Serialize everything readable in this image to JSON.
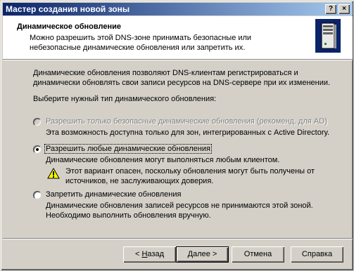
{
  "window": {
    "title": "Мастер создания новой зоны",
    "help_glyph": "?",
    "close_glyph": "×"
  },
  "header": {
    "title": "Динамическое обновление",
    "description": "Можно разрешить этой DNS-зоне принимать безопасные или небезопасные динамические обновления или запретить их.",
    "icon": "server-icon"
  },
  "body": {
    "intro": "Динамические обновления позволяют DNS-клиентам регистрироваться и динамически обновлять свои записи ресурсов на DNS-сервере при их изменении.",
    "prompt": "Выберите нужный тип динамического обновления:"
  },
  "options": [
    {
      "label": "Разрешить только безопасные динамические обновления (рекоменд. для AD)",
      "description": "Эта возможность доступна только для зон, интегрированных с Active Directory.",
      "state": "disabled"
    },
    {
      "label": "Разрешить любые динамические обновления",
      "description": "Динамические обновления могут выполняться любым клиентом.",
      "warning": "Этот вариант опасен, поскольку обновления могут быть получены от источников, не заслуживающих доверия.",
      "state": "selected"
    },
    {
      "label": "Запретить динамические обновления",
      "description": "Динамические обновления записей ресурсов не принимаются этой зоной. Необходимо выполнить обновления вручную.",
      "state": "unselected"
    }
  ],
  "buttons": {
    "back_prefix": "< ",
    "back_key": "Н",
    "back_rest": "азад",
    "next_key": "Д",
    "next_rest": "алее >",
    "cancel": "Отмена",
    "help": "Справка"
  }
}
